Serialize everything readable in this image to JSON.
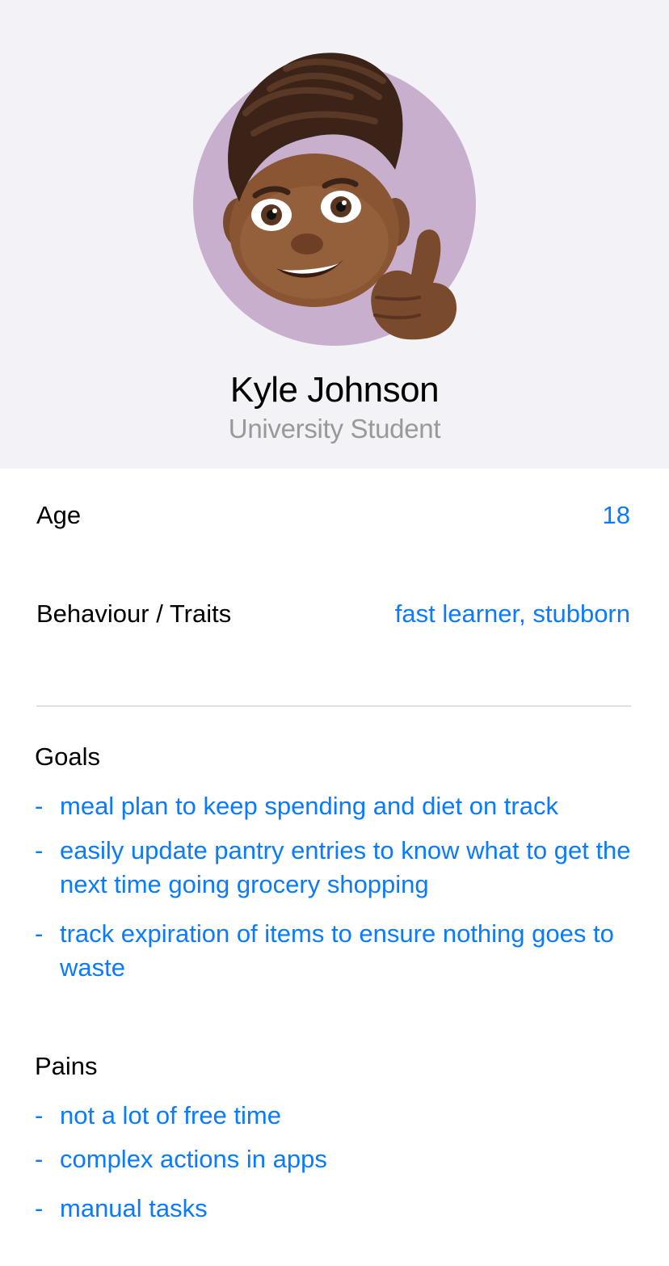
{
  "profile": {
    "name": "Kyle Johnson",
    "role": "University Student"
  },
  "details": {
    "age_label": "Age",
    "age_value": "18",
    "traits_label": "Behaviour / Traits",
    "traits_value": "fast learner, stubborn"
  },
  "goals": {
    "title": "Goals",
    "items": [
      "meal plan to keep spending and diet on track",
      "easily update pantry entries to know what to get the next time going grocery shopping",
      "track expiration of items to ensure nothing goes to waste"
    ]
  },
  "pains": {
    "title": "Pains",
    "items": [
      "not a lot of free time",
      "complex actions in apps",
      "manual tasks"
    ]
  },
  "bullet_marker": "-",
  "colors": {
    "accent": "#0a7aff",
    "header_bg": "#f2f2f7",
    "avatar_circle": "#c8afce",
    "secondary_text": "#999999"
  }
}
